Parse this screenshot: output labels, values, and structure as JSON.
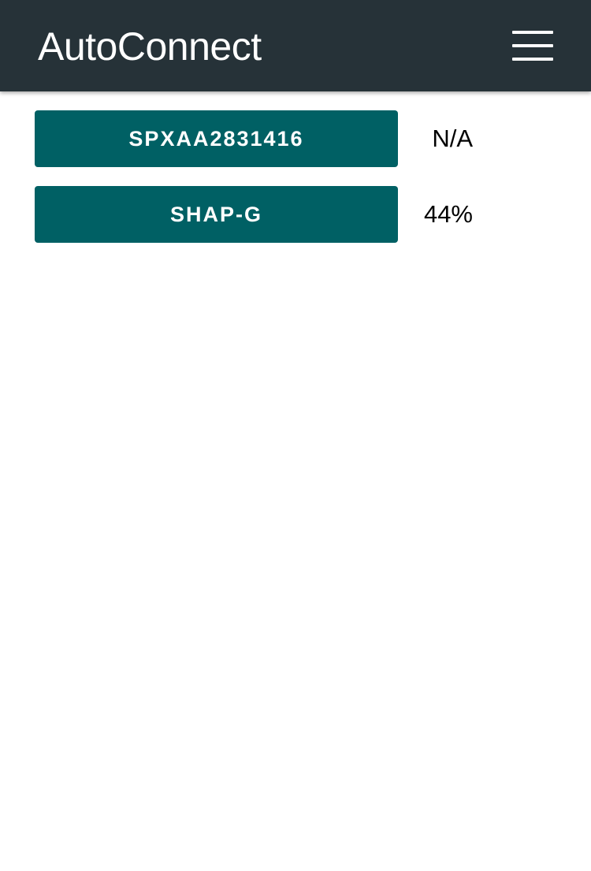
{
  "header": {
    "title": "AutoConnect",
    "menu_icon": "hamburger-menu-icon",
    "background_color": "#263238"
  },
  "access_points": [
    {
      "ssid": "SPXAA2831416",
      "signal": "N/A"
    },
    {
      "ssid": "SHAP-G",
      "signal": "44%"
    }
  ],
  "colors": {
    "button": "#006064",
    "button_text": "#ffffff",
    "text": "#000000"
  }
}
